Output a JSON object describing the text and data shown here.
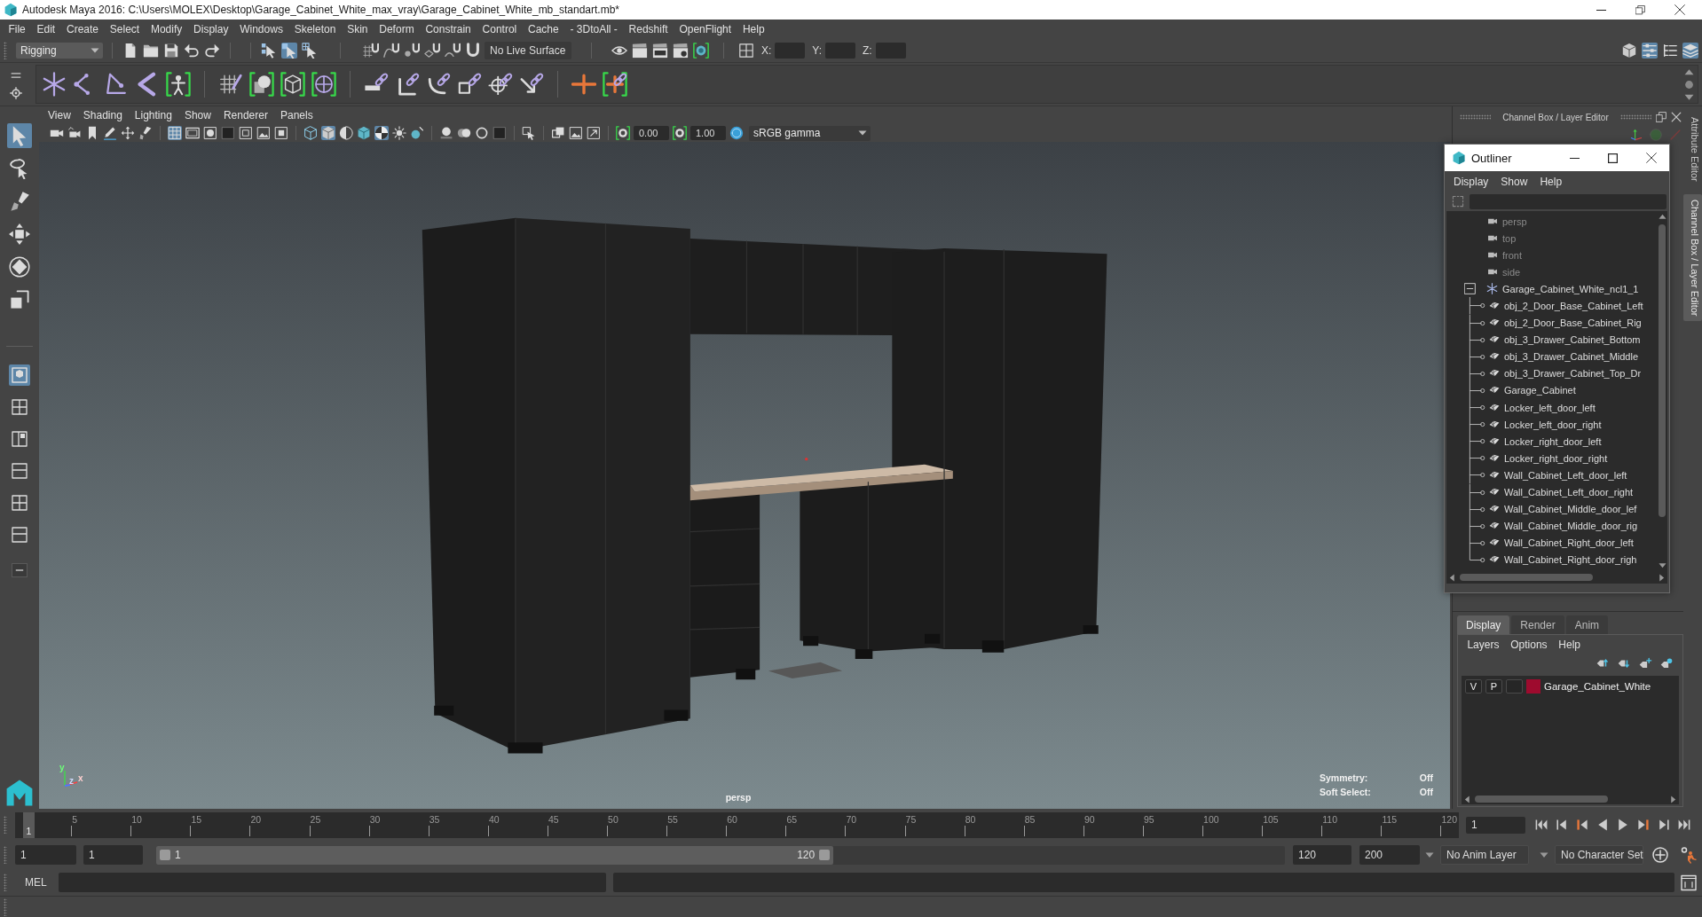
{
  "window": {
    "title": "Autodesk Maya 2016: C:\\Users\\MOLEX\\Desktop\\Garage_Cabinet_White_max_vray\\Garage_Cabinet_White_mb_standart.mb*"
  },
  "menu_bar": [
    "File",
    "Edit",
    "Create",
    "Select",
    "Modify",
    "Display",
    "Windows",
    "Skeleton",
    "Skin",
    "Deform",
    "Constrain",
    "Control",
    "Cache",
    "- 3DtoAll -",
    "Redshift",
    "OpenFlight",
    "Help"
  ],
  "status_line": {
    "mode": "Rigging",
    "select_modes": [
      {
        "on": false
      },
      {
        "on": true
      },
      {
        "on": false
      }
    ],
    "live_surface": "No Live Surface",
    "coordinate_labels": [
      "X:",
      "Y:",
      "Z:"
    ],
    "panel_toggles": [
      {
        "on": false
      },
      {
        "on": true
      },
      {
        "on": false
      },
      {
        "on": true
      }
    ]
  },
  "toolbox": {
    "tools": [
      {
        "selected": true
      },
      {
        "selected": false
      },
      {
        "selected": false
      },
      {
        "selected": false
      },
      {
        "selected": false
      },
      {
        "selected": false
      }
    ],
    "layouts": [
      {
        "selected": true
      },
      {
        "selected": false
      },
      {
        "selected": false
      },
      {
        "selected": false
      },
      {
        "selected": false
      },
      {
        "selected": false
      }
    ]
  },
  "viewport": {
    "menu": [
      "View",
      "Shading",
      "Lighting",
      "Show",
      "Renderer",
      "Panels"
    ],
    "display_toggles": [
      {
        "on": true
      },
      {
        "on": false
      },
      {
        "on": false
      },
      {
        "on": false
      },
      {
        "on": false
      },
      {
        "on": false
      },
      {
        "on": false
      }
    ],
    "shading_toggles": [
      {
        "on": false
      },
      {
        "on": true
      },
      {
        "on": false
      },
      {
        "on": false
      },
      {
        "on": true
      }
    ],
    "exposure": "0.00",
    "gamma": "1.00",
    "color_space": "sRGB gamma",
    "hud": [
      {
        "label": "Symmetry:",
        "value": "Off"
      },
      {
        "label": "Soft Select:",
        "value": "Off"
      }
    ],
    "camera": "persp",
    "axis_labels": [
      "y",
      "z",
      "x"
    ]
  },
  "outliner": {
    "title": "Outliner",
    "menu": [
      "Display",
      "Show",
      "Help"
    ],
    "items": [
      {
        "kind": "camera",
        "label": "persp",
        "dimmed": true
      },
      {
        "kind": "camera",
        "label": "top",
        "dimmed": true
      },
      {
        "kind": "camera",
        "label": "front",
        "dimmed": true
      },
      {
        "kind": "camera",
        "label": "side",
        "dimmed": true
      },
      {
        "kind": "group",
        "label": "Garage_Cabinet_White_ncl1_1",
        "dimmed": false,
        "expanded": true,
        "children": [
          {
            "kind": "mesh",
            "label": "obj_2_Door_Base_Cabinet_Left",
            "dimmed": false
          },
          {
            "kind": "mesh",
            "label": "obj_2_Door_Base_Cabinet_Rig",
            "dimmed": false
          },
          {
            "kind": "mesh",
            "label": "obj_3_Drawer_Cabinet_Bottom",
            "dimmed": false
          },
          {
            "kind": "mesh",
            "label": "obj_3_Drawer_Cabinet_Middle",
            "dimmed": false
          },
          {
            "kind": "mesh",
            "label": "obj_3_Drawer_Cabinet_Top_Dr",
            "dimmed": false
          },
          {
            "kind": "mesh",
            "label": "Garage_Cabinet",
            "dimmed": false
          },
          {
            "kind": "mesh",
            "label": "Locker_left_door_left",
            "dimmed": false
          },
          {
            "kind": "mesh",
            "label": "Locker_left_door_right",
            "dimmed": false
          },
          {
            "kind": "mesh",
            "label": "Locker_right_door_left",
            "dimmed": false
          },
          {
            "kind": "mesh",
            "label": "Locker_right_door_right",
            "dimmed": false
          },
          {
            "kind": "mesh",
            "label": "Wall_Cabinet_Left_door_left",
            "dimmed": false
          },
          {
            "kind": "mesh",
            "label": "Wall_Cabinet_Left_door_right",
            "dimmed": false
          },
          {
            "kind": "mesh",
            "label": "Wall_Cabinet_Middle_door_lef",
            "dimmed": false
          },
          {
            "kind": "mesh",
            "label": "Wall_Cabinet_Middle_door_rig",
            "dimmed": false
          },
          {
            "kind": "mesh",
            "label": "Wall_Cabinet_Right_door_left",
            "dimmed": false
          },
          {
            "kind": "mesh",
            "label": "Wall_Cabinet_Right_door_righ",
            "dimmed": false
          }
        ]
      }
    ]
  },
  "channel_box": {
    "title": "Channel Box / Layer Editor"
  },
  "side_tabs": [
    {
      "label": "Attribute Editor",
      "selected": false
    },
    {
      "label": "Channel Box / Layer Editor",
      "selected": true
    }
  ],
  "layer_editor": {
    "tabs": [
      {
        "label": "Display",
        "selected": true
      },
      {
        "label": "Render",
        "selected": false
      },
      {
        "label": "Anim",
        "selected": false
      }
    ],
    "menu": [
      "Layers",
      "Options",
      "Help"
    ],
    "layers": [
      {
        "visibility": "V",
        "playback": "P",
        "color": "#9e0b2e",
        "name": "Garage_Cabinet_White"
      }
    ]
  },
  "time_slider": {
    "marker": "1",
    "level": 0,
    "frame_labels": [
      "5",
      "10",
      "15",
      "20",
      "25",
      "30",
      "35",
      "40",
      "45",
      "50",
      "55",
      "60",
      "65",
      "70",
      "75",
      "80",
      "85",
      "90",
      "95",
      "100",
      "105",
      "110",
      "115",
      "120"
    ],
    "current_frame": "1"
  },
  "range_slider": {
    "start": "1",
    "playback_start": "1",
    "min_label": "1",
    "max_label": "120",
    "level": 0.6,
    "playback_end": "120",
    "end": "200",
    "anim_layer": "No Anim Layer",
    "character_set": "No Character Set"
  },
  "command_line": {
    "language": "MEL"
  }
}
